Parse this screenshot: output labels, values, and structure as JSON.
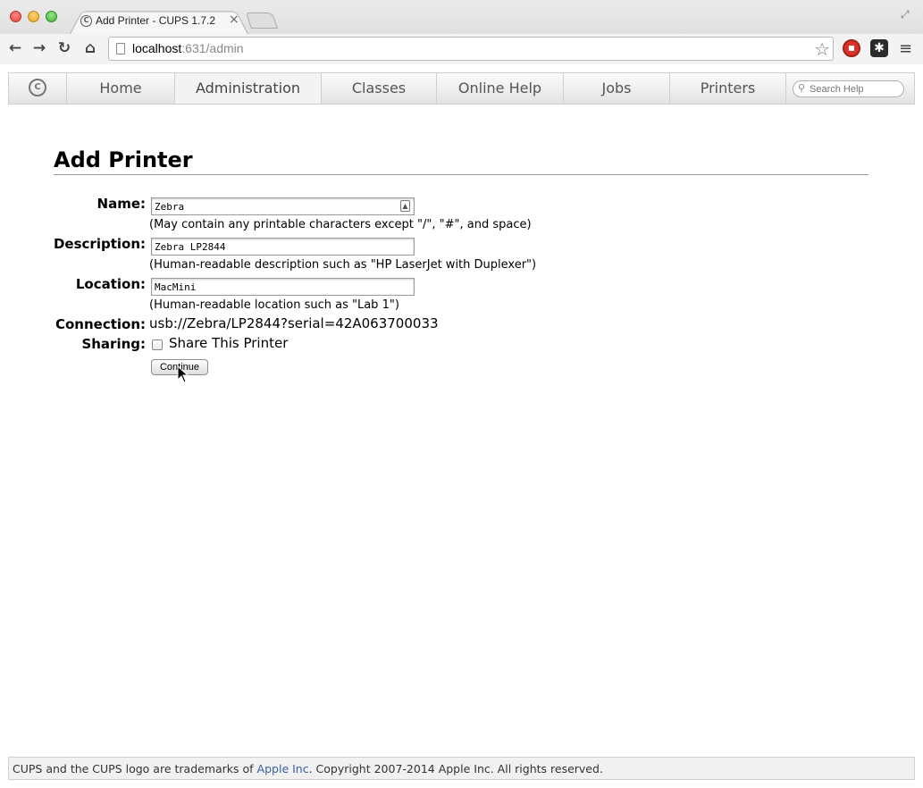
{
  "browser": {
    "tab_title": "Add Printer - CUPS 1.7.2",
    "tab_close": "×",
    "url_host": "localhost",
    "url_rest": ":631/admin"
  },
  "nav": {
    "tabs": [
      {
        "label": "Home",
        "active": false
      },
      {
        "label": "Administration",
        "active": true
      },
      {
        "label": "Classes",
        "active": false
      },
      {
        "label": "Online Help",
        "active": false
      },
      {
        "label": "Jobs",
        "active": false
      },
      {
        "label": "Printers",
        "active": false
      }
    ],
    "search_placeholder": "Search Help"
  },
  "page": {
    "title": "Add Printer",
    "form": {
      "name_label": "Name:",
      "name_value": "Zebra",
      "name_hint": "(May contain any printable characters except \"/\", \"#\", and space)",
      "description_label": "Description:",
      "description_value": "Zebra LP2844",
      "description_hint": "(Human-readable description such as \"HP LaserJet with Duplexer\")",
      "location_label": "Location:",
      "location_value": "MacMini",
      "location_hint": "(Human-readable location such as \"Lab 1\")",
      "connection_label": "Connection:",
      "connection_value": "usb://Zebra/LP2844?serial=42A063700033",
      "sharing_label": "Sharing:",
      "sharing_text": "Share This Printer",
      "sharing_checked": false,
      "continue_label": "Continue"
    }
  },
  "footer": {
    "prefix": "CUPS and the CUPS logo are trademarks of ",
    "link": "Apple Inc",
    "suffix": ". Copyright 2007-2014 Apple Inc. All rights reserved."
  }
}
